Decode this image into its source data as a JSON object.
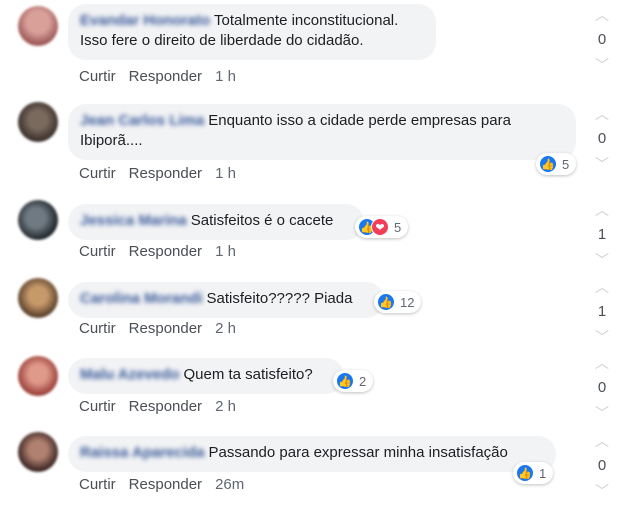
{
  "actions": {
    "reply_like": "Curtir",
    "reply": "Responder"
  },
  "icons": {
    "like": "thumbs-up-icon",
    "love": "heart-icon",
    "upvote": "chevron-up-icon",
    "downvote": "chevron-down-icon"
  },
  "colors": {
    "link": "#385898",
    "bubble": "#f2f3f5",
    "like": "#1877f2",
    "love": "#f33e58"
  },
  "comments": [
    {
      "author": "Evandar Honorato",
      "text": "Totalmente inconstitucional.\nIsso fere o direito de liberdade do cidadão.",
      "time": "1 h",
      "reactions": "",
      "score": "0"
    },
    {
      "author": "Jean Carlos Lima",
      "text": "Enquanto isso a cidade perde empresas para\nIbiporã....",
      "time": "1 h",
      "reactions": "5",
      "score": "0"
    },
    {
      "author": "Jessica Marina",
      "text": "Satisfeitos é o cacete",
      "time": "1 h",
      "reactions": "5",
      "score": "1"
    },
    {
      "author": "Carolina Morandi",
      "text": "Satisfeito????? Piada",
      "time": "2 h",
      "reactions": "12",
      "score": "1"
    },
    {
      "author": "Malu Azevedo",
      "text": "Quem ta satisfeito?",
      "time": "2 h",
      "reactions": "2",
      "score": "0"
    },
    {
      "author": "Raissa Aparecida",
      "text": "Passando para expressar minha insatisfação",
      "time": "26m",
      "reactions": "1",
      "score": "0"
    }
  ]
}
